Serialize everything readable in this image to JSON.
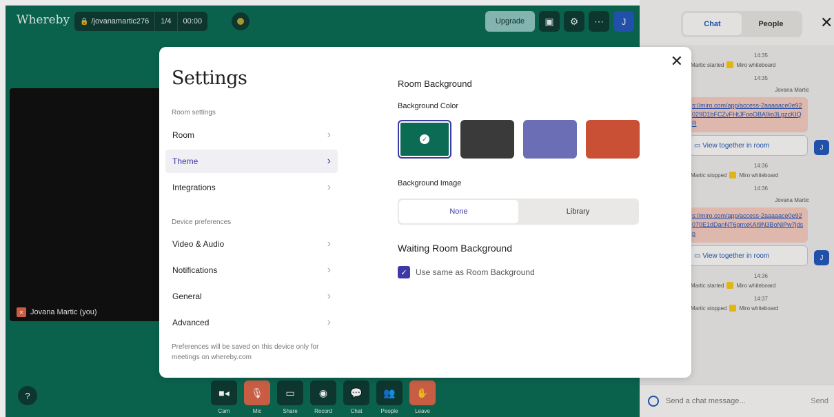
{
  "topbar": {
    "logo": "Whereby",
    "room_name": "/jovanamartic276",
    "participants": "1/4",
    "timer": "00:00",
    "upgrade_label": "Upgrade",
    "avatar_initial": "J"
  },
  "video": {
    "name": "Jovana Martic (you)"
  },
  "bottombar": {
    "items": [
      {
        "label": "Cam",
        "icon": "camera-icon"
      },
      {
        "label": "Mic",
        "icon": "mic-off-icon"
      },
      {
        "label": "Share",
        "icon": "screen-share-icon"
      },
      {
        "label": "Record",
        "icon": "record-icon"
      },
      {
        "label": "Chat",
        "icon": "chat-icon"
      },
      {
        "label": "People",
        "icon": "people-icon"
      },
      {
        "label": "Leave",
        "icon": "leave-hand-icon"
      }
    ],
    "help": "?"
  },
  "settings": {
    "title": "Settings",
    "room_settings_label": "Room settings",
    "device_prefs_label": "Device preferences",
    "nav": [
      {
        "label": "Room"
      },
      {
        "label": "Theme"
      },
      {
        "label": "Integrations"
      },
      {
        "label": "Video & Audio"
      },
      {
        "label": "Notifications"
      },
      {
        "label": "General"
      },
      {
        "label": "Advanced"
      }
    ],
    "active_nav": "Theme",
    "footnote": "Preferences will be saved on this device only for meetings on whereby.com",
    "room_background_title": "Room Background",
    "background_color_label": "Background Color",
    "colors": [
      "#0b6b54",
      "#3a3a3a",
      "#6b6db5",
      "#c94f35"
    ],
    "selected_color_index": 0,
    "background_image_label": "Background Image",
    "image_options": [
      "None",
      "Library"
    ],
    "selected_image": "None",
    "waiting_room_title": "Waiting Room Background",
    "use_same_label": "Use same as Room Background",
    "use_same_checked": true
  },
  "chat": {
    "tabs": [
      "Chat",
      "People"
    ],
    "active_tab": "Chat",
    "messages": {
      "t1": "14:35",
      "e1": "Martic started",
      "e1_app": "Miro whiteboard",
      "t2": "14:35",
      "sender1": "Jovana Martic",
      "link1": "s://miro.com/app/access-2aaaaace0e92029D1bFCZvFHtJFooOBA9io3LgzcKIQR",
      "view1": "View together in room",
      "t3": "14:36",
      "e2": "Martic stopped",
      "e2_app": "Miro whiteboard",
      "t4": "14:36",
      "sender2": "Jovana Martic",
      "link2": "s://miro.com/app/access-2aaaaace0e92070E1dDanNT6gmxKAI9N3BoNiPw7jdsp",
      "view2": "View together in room",
      "t5": "14:36",
      "e3": "Martic started",
      "e3_app": "Miro whiteboard",
      "t6": "14:37",
      "e4": "Martic stopped",
      "e4_app": "Miro whiteboard",
      "avatar": "J"
    },
    "input_placeholder": "Send a chat message...",
    "send_label": "Send"
  }
}
